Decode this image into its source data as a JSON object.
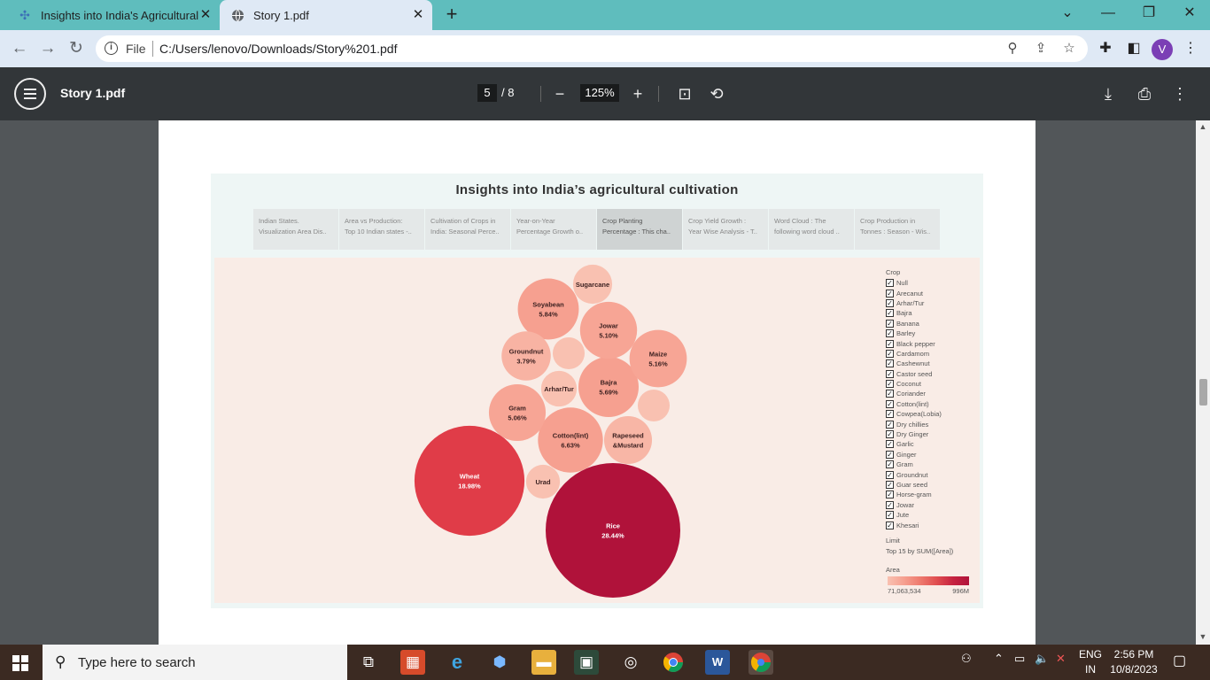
{
  "browser": {
    "tabs": [
      {
        "title": "Insights into India's Agricultural",
        "icon": "tableau-icon"
      },
      {
        "title": "Story 1.pdf",
        "icon": "globe-icon"
      }
    ],
    "file_label": "File",
    "url": "C:/Users/lenovo/Downloads/Story%201.pdf",
    "avatar_letter": "V"
  },
  "pdf_toolbar": {
    "title": "Story 1.pdf",
    "page_current": "5",
    "page_total": "/ 8",
    "zoom": "125%"
  },
  "dashboard": {
    "title": "Insights into India’s agricultural cultivation",
    "story_points": [
      {
        "line1": "Indian States.",
        "line2": "Visualization Area Dis.."
      },
      {
        "line1": "Area vs Production:",
        "line2": "Top 10 Indian states -.."
      },
      {
        "line1": "Cultivation of Crops in",
        "line2": "India: Seasonal Perce.."
      },
      {
        "line1": "Year-on-Year",
        "line2": "Percentage Growth o.."
      },
      {
        "line1": "Crop Planting",
        "line2": "Percentage : This cha.."
      },
      {
        "line1": "Crop Yield Growth :",
        "line2": "Year Wise Analysis - T.."
      },
      {
        "line1": "Word Cloud : The",
        "line2": "following word cloud .."
      },
      {
        "line1": "Crop Production in",
        "line2": "Tonnes : Season - Wis.."
      }
    ],
    "active_story_point": 4,
    "legend_title": "Crop",
    "legend_items": [
      "Null",
      "Arecanut",
      "Arhar/Tur",
      "Bajra",
      "Banana",
      "Barley",
      "Black pepper",
      "Cardamom",
      "Cashewnut",
      "Castor seed",
      "Coconut",
      "Coriander",
      "Cotton(lint)",
      "Cowpea(Lobia)",
      "Dry chillies",
      "Dry Ginger",
      "Garlic",
      "Ginger",
      "Gram",
      "Groundnut",
      "Guar seed",
      "Horse-gram",
      "Jowar",
      "Jute",
      "Khesari"
    ],
    "limit_label": "Limit",
    "limit_value": "Top 15 by SUM([Area])",
    "area_legend_title": "Area",
    "area_min": "71,063,534",
    "area_max": "996M"
  },
  "chart_data": {
    "type": "bubble",
    "title": "",
    "size_measure": "Area",
    "bubbles": [
      {
        "name": "Rice",
        "percent": "28.44%",
        "value": 28.44,
        "color": "#b0123a"
      },
      {
        "name": "Wheat",
        "percent": "18.98%",
        "value": 18.98,
        "color": "#e03c48"
      },
      {
        "name": "Cotton(lint)",
        "percent": "6.63%",
        "value": 6.63,
        "color": "#f6a090"
      },
      {
        "name": "Soyabean",
        "percent": "5.84%",
        "value": 5.84,
        "color": "#f6a090"
      },
      {
        "name": "Bajra",
        "percent": "5.69%",
        "value": 5.69,
        "color": "#f6a090"
      },
      {
        "name": "Maize",
        "percent": "5.16%",
        "value": 5.16,
        "color": "#f7a595"
      },
      {
        "name": "Jowar",
        "percent": "5.10%",
        "value": 5.1,
        "color": "#f7a595"
      },
      {
        "name": "Gram",
        "percent": "5.06%",
        "value": 5.06,
        "color": "#f7a595"
      },
      {
        "name": "Groundnut",
        "percent": "3.79%",
        "value": 3.79,
        "color": "#f8b3a3"
      },
      {
        "name": "Rapeseed &Mustard",
        "percent": "",
        "value": 3.6,
        "color": "#f8b6a6"
      },
      {
        "name": "Sugarcane",
        "percent": "",
        "value": 2.4,
        "color": "#f9c1b1"
      },
      {
        "name": "Arhar/Tur",
        "percent": "",
        "value": 2.0,
        "color": "#f9c1b1"
      },
      {
        "name": "Urad",
        "percent": "",
        "value": 1.8,
        "color": "#f9c1b1"
      },
      {
        "name": "",
        "percent": "",
        "value": 1.6,
        "color": "#f9c1b1"
      },
      {
        "name": "",
        "percent": "",
        "value": 1.6,
        "color": "#f9c1b1"
      }
    ]
  },
  "taskbar": {
    "search_placeholder": "Type here to search",
    "lang_line1": "ENG",
    "lang_line2": "IN",
    "time": "2:56 PM",
    "date": "10/8/2023"
  }
}
